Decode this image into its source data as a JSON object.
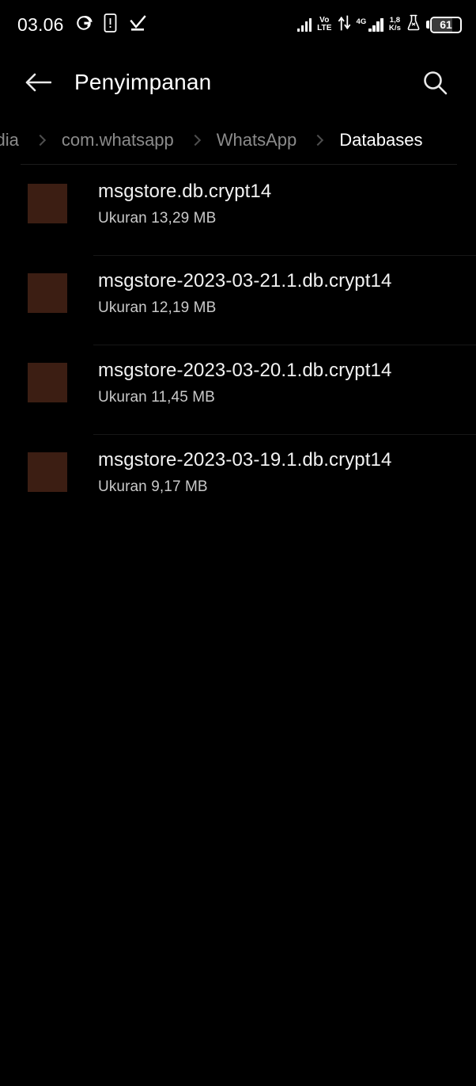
{
  "status_bar": {
    "clock": "03.06",
    "google_icon_label": "G",
    "left_icons": [
      "google-g-icon",
      "phone-alert-icon",
      "download-complete-icon"
    ],
    "network_label_line1": "Vo",
    "network_label_line2": "LTE",
    "data_type": "4G",
    "data_rate_value": "1,8",
    "data_rate_unit": "K/s",
    "lab_icon": "flask-icon",
    "battery_percent": "61"
  },
  "app_bar": {
    "back_label": "back-arrow",
    "title": "Penyimpanan",
    "search_label": "search"
  },
  "breadcrumb": {
    "items": [
      {
        "label": "media",
        "active": false
      },
      {
        "label": "com.whatsapp",
        "active": false
      },
      {
        "label": "WhatsApp",
        "active": false
      },
      {
        "label": "Databases",
        "active": true
      }
    ]
  },
  "files": {
    "size_color": "#c9c9c9",
    "icon_color": "#3c1e13",
    "items": [
      {
        "name": "msgstore.db.crypt14",
        "size": "Ukuran 13,29 MB"
      },
      {
        "name": "msgstore-2023-03-21.1.db.crypt14",
        "size": "Ukuran 12,19 MB"
      },
      {
        "name": "msgstore-2023-03-20.1.db.crypt14",
        "size": "Ukuran 11,45 MB"
      },
      {
        "name": "msgstore-2023-03-19.1.db.crypt14",
        "size": "Ukuran 9,17 MB"
      }
    ]
  },
  "theme": {
    "background": "#000000",
    "text_primary": "#f2f2f2",
    "text_secondary": "#8b8b8b",
    "divider": "#1c1c1c"
  }
}
